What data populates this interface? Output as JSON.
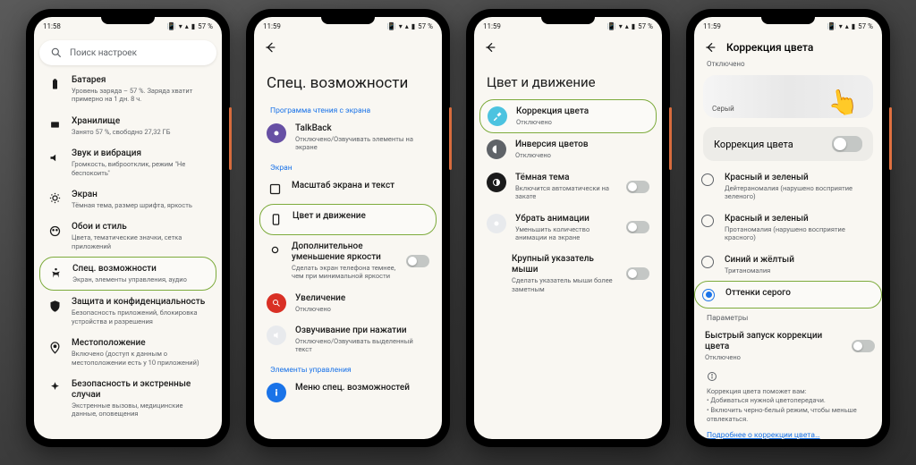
{
  "status": {
    "time1": "11:58",
    "time2": "11:59",
    "battery": "57 %"
  },
  "s1": {
    "search": "Поиск настроек",
    "items": [
      {
        "title": "Батарея",
        "sub": "Уровень заряда – 57 %. Заряда хватит примерно на 1 дн. 8 ч."
      },
      {
        "title": "Хранилище",
        "sub": "Занято 57 %, свободно 27,32 ГБ"
      },
      {
        "title": "Звук и вибрация",
        "sub": "Громкость, виброотклик, режим \"Не беспокоить\""
      },
      {
        "title": "Экран",
        "sub": "Тёмная тема, размер шрифта, яркость"
      },
      {
        "title": "Обои и стиль",
        "sub": "Цвета, тематические значки, сетка приложений"
      },
      {
        "title": "Спец. возможности",
        "sub": "Экран, элементы управления, аудио"
      },
      {
        "title": "Защита и конфиденциальность",
        "sub": "Безопасность приложений, блокировка устройства и разрешения"
      },
      {
        "title": "Местоположение",
        "sub": "Включено (доступ к данным о местоположении есть у 10 приложений)"
      },
      {
        "title": "Безопасность и экстренные случаи",
        "sub": "Экстренные вызовы, медицинские данные, оповещения"
      }
    ]
  },
  "s2": {
    "title": "Спец. возможности",
    "reader_section": "Программа чтения с экрана",
    "screen_section": "Экран",
    "controls_section": "Элементы управления",
    "items": {
      "talkback": {
        "title": "TalkBack",
        "sub": "Отключено/Озвучивать элементы на экране"
      },
      "scale": {
        "title": "Масштаб экрана и текст"
      },
      "color": {
        "title": "Цвет и движение"
      },
      "dim": {
        "title": "Дополнительное уменьшение яркости",
        "sub": "Сделать экран телефона темнее, чем при минимальной яркости"
      },
      "mag": {
        "title": "Увеличение",
        "sub": "Отключено"
      },
      "speak": {
        "title": "Озвучивание при нажатии",
        "sub": "Отключено/Озвучивать выделенный текст"
      },
      "menu": {
        "title": "Меню спец. возможностей"
      }
    }
  },
  "s3": {
    "title": "Цвет и движение",
    "items": {
      "corr": {
        "title": "Коррекция цвета",
        "sub": "Отключено"
      },
      "inv": {
        "title": "Инверсия цветов",
        "sub": "Отключено"
      },
      "dark": {
        "title": "Тёмная тема",
        "sub": "Включится автоматически на закате"
      },
      "anim": {
        "title": "Убрать анимации",
        "sub": "Уменьшить количество анимации на экране"
      },
      "mouse": {
        "title": "Крупный указатель мыши",
        "sub": "Сделать указатель мыши более заметным"
      }
    }
  },
  "s4": {
    "title": "Коррекция цвета",
    "sub": "Отключено",
    "preview": "Серый",
    "toggle_label": "Коррекция цвета",
    "options": [
      {
        "title": "Красный и зеленый",
        "sub": "Дейтераномалия (нарушено восприятие зеленого)"
      },
      {
        "title": "Красный и зеленый",
        "sub": "Протаномалия (нарушено восприятие красного)"
      },
      {
        "title": "Синий и жёлтый",
        "sub": "Тританомалия"
      },
      {
        "title": "Оттенки серого",
        "sub": ""
      }
    ],
    "params": "Параметры",
    "quick": {
      "title": "Быстрый запуск коррекции цвета",
      "sub": "Отключено"
    },
    "info_lead": "Коррекция цвета поможет вам:",
    "info_b1": "• Добиваться нужной цветопередачи.",
    "info_b2": "• Включить черно-белый режим, чтобы меньше отвлекаться.",
    "more": "Подробнее о коррекции цвета…"
  }
}
